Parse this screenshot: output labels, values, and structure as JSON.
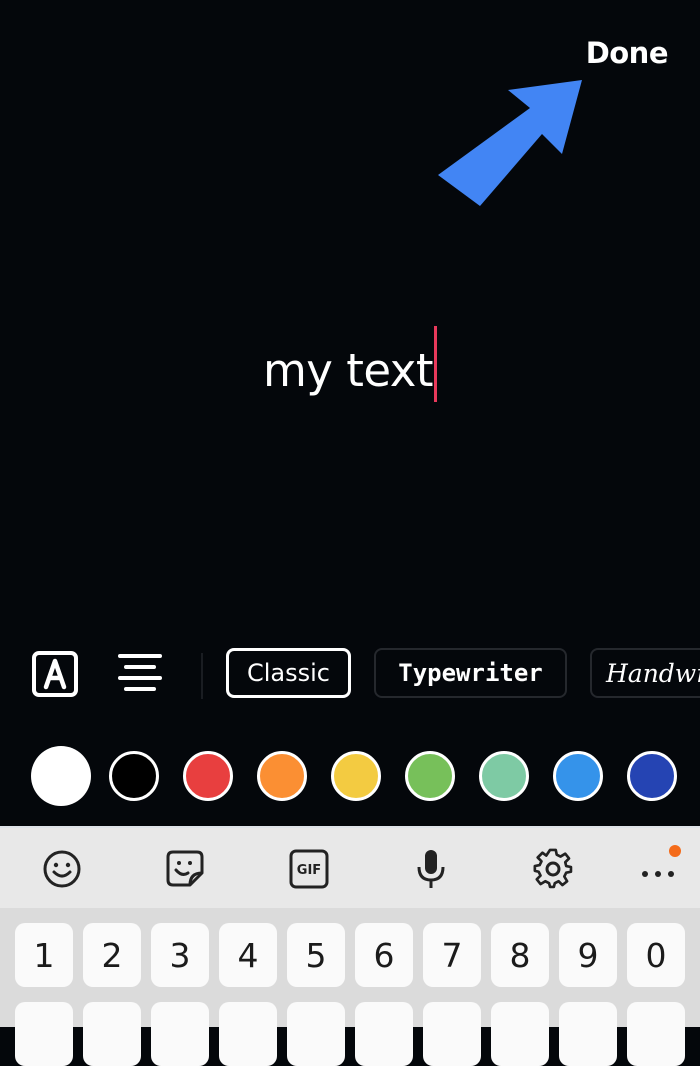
{
  "editor": {
    "done_label": "Done",
    "typed_text": "my text",
    "arrow_color": "#4285f4",
    "caret_color": "#e8395b"
  },
  "toolbar": {
    "font_icon": "text-style-icon",
    "align_icon": "align-center-icon",
    "styles": [
      {
        "label": "Classic",
        "selected": true
      },
      {
        "label": "Typewriter",
        "selected": false
      },
      {
        "label": "Handwriting",
        "selected": false
      }
    ]
  },
  "colors": [
    {
      "name": "white",
      "hex": "#ffffff",
      "selected": true
    },
    {
      "name": "black",
      "hex": "#000000",
      "selected": false
    },
    {
      "name": "red",
      "hex": "#e83f3f",
      "selected": false
    },
    {
      "name": "orange",
      "hex": "#fb8f33",
      "selected": false
    },
    {
      "name": "yellow",
      "hex": "#f3cb41",
      "selected": false
    },
    {
      "name": "green",
      "hex": "#77c05a",
      "selected": false
    },
    {
      "name": "mint",
      "hex": "#7ecaa4",
      "selected": false
    },
    {
      "name": "blue",
      "hex": "#3593ea",
      "selected": false
    },
    {
      "name": "dark-blue",
      "hex": "#2544b3",
      "selected": false
    }
  ],
  "keyboard": {
    "toolbar": [
      "emoji-icon",
      "sticker-icon",
      "gif-icon",
      "microphone-icon",
      "settings-icon",
      "more-icon"
    ],
    "gif_label": "GIF",
    "notification_color": "#f46b1a",
    "number_row": [
      "1",
      "2",
      "3",
      "4",
      "5",
      "6",
      "7",
      "8",
      "9",
      "0"
    ]
  }
}
